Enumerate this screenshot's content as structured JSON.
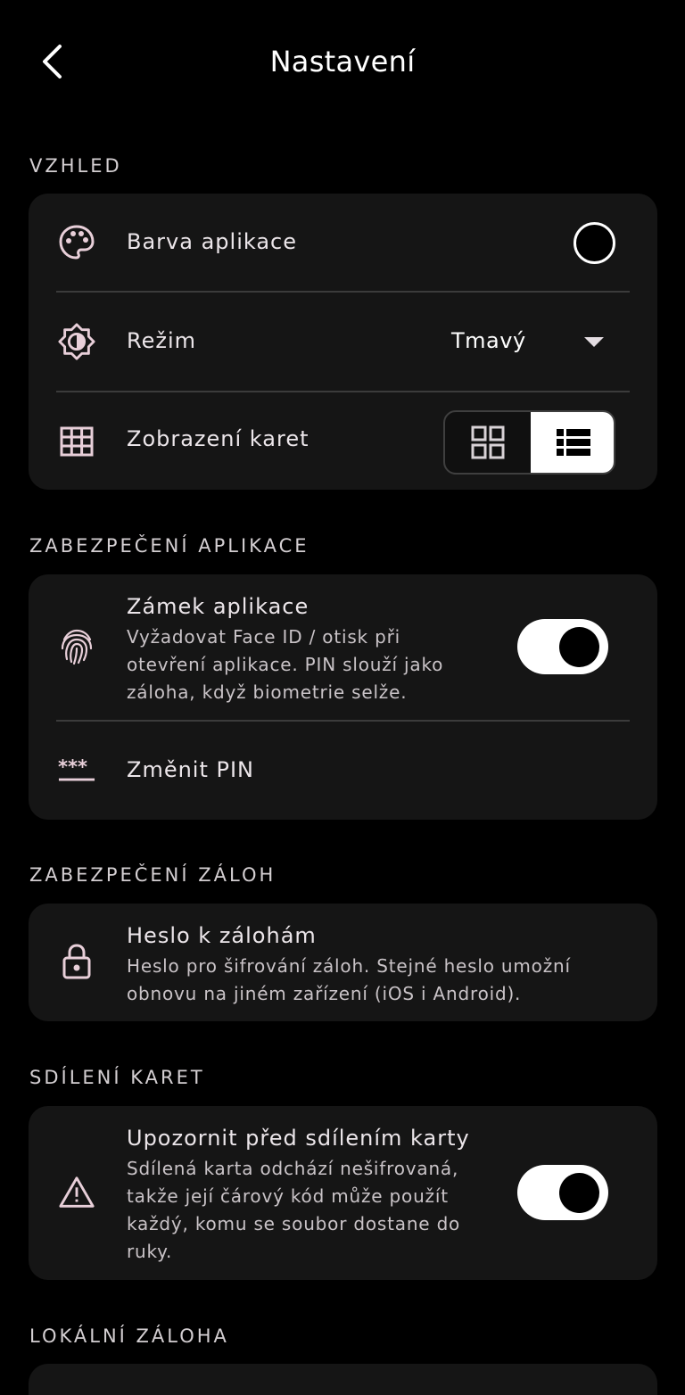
{
  "header": {
    "title": "Nastavení"
  },
  "sections": {
    "appearance": {
      "label": "VZHLED",
      "app_color": {
        "title": "Barva aplikace"
      },
      "mode": {
        "title": "Režim",
        "value": "Tmavý"
      },
      "card_view": {
        "title": "Zobrazení karet",
        "selected": "list"
      }
    },
    "app_security": {
      "label": "ZABEZPEČENÍ APLIKACE",
      "app_lock": {
        "title": "Zámek aplikace",
        "subtitle_lines": [
          "Vyžadovat Face ID / otisk při",
          "otevření aplikace. PIN slouží jako",
          "záloha, když biometrie selže."
        ],
        "enabled": true
      },
      "change_pin": {
        "title": "Změnit PIN"
      }
    },
    "backup_security": {
      "label": "ZABEZPEČENÍ ZÁLOH",
      "backup_password": {
        "title": "Heslo k zálohám",
        "subtitle_lines": [
          "Heslo pro šifrování záloh. Stejné heslo umožní",
          "obnovu na jiném zařízení (iOS i Android)."
        ]
      }
    },
    "card_sharing": {
      "label": "SDÍLENÍ KARET",
      "warn_before_share": {
        "title": "Upozornit před sdílením karty",
        "subtitle_lines": [
          "Sdílená karta odchází nešifrovaná,",
          "takže její čárový kód může použít",
          "každý, komu se soubor dostane do",
          "ruky."
        ],
        "enabled": true
      }
    },
    "local_backup": {
      "label": "LOKÁLNÍ ZÁLOHA"
    }
  },
  "colors": {
    "background": "#000000",
    "card": "#151515",
    "divider": "#3b3b3b",
    "text": "#ece6ea",
    "icon": "#e8cfd9",
    "toggle_on": "#ffffff"
  }
}
